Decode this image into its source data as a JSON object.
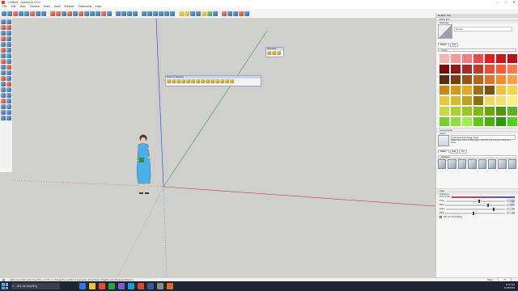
{
  "window": {
    "title": "Untitled - SketchUp 2019",
    "controls": [
      "–",
      "□",
      "✕"
    ]
  },
  "menu": [
    "File",
    "Edit",
    "View",
    "Camera",
    "Draw",
    "Tools",
    "Window",
    "Extensions",
    "Help"
  ],
  "floating": {
    "standard": {
      "title": "Standard"
    },
    "views": {
      "title": "Tools on Surface"
    }
  },
  "tray": {
    "title": "Default Tray",
    "entity_info": "Entity Info",
    "materials": {
      "header": "Materials",
      "name_placeholder": "Default",
      "tabs": [
        "Select",
        "Edit"
      ],
      "category": "Colors",
      "swatch_colors": [
        "#f7b6b6",
        "#f59a9a",
        "#f07f7f",
        "#e84d4d",
        "#e02020",
        "#c81818",
        "#b01414",
        "#7a0c0c",
        "#8b1a1a",
        "#a52a2a",
        "#c0392b",
        "#e74c3c",
        "#ff5a36",
        "#ff7a4f",
        "#5a2e0c",
        "#7a3f10",
        "#9a5216",
        "#b8641e",
        "#d8782a",
        "#f08c30",
        "#ffa040",
        "#c68a1a",
        "#d49a20",
        "#e0aa28",
        "#a07018",
        "#7a5410",
        "#f2c040",
        "#ffd24a",
        "#e6c840",
        "#d8b830",
        "#c4a020",
        "#8a7010",
        "#f0d860",
        "#f8e070",
        "#fff080",
        "#c8d840",
        "#b0d030",
        "#98c820",
        "#80b818",
        "#68a810",
        "#509808",
        "#60b020",
        "#7ad030",
        "#8ee040",
        "#a0f050",
        "#60c818",
        "#48b010",
        "#309808",
        "#50d020"
      ]
    },
    "components": "Components",
    "styles": {
      "header": "Styles",
      "style_name": "Architectural Design Style",
      "style_desc": "Default face colors. Profile edges. Light blue sky and gray background colors.",
      "tabs": [
        "Select",
        "Edit",
        "Mix"
      ],
      "category": "In Model",
      "thumbs": 8
    },
    "tags": "Tags",
    "shadows": {
      "header": "Shadows",
      "tz": "UTC-07:00",
      "time_label": "Time",
      "time_val": "01:30 PM",
      "date_label": "Date",
      "date_val": "11/08",
      "light_label": "Light",
      "light_val": "80",
      "dark_label": "Dark",
      "dark_val": "45",
      "sun_label": "Use sun for shading"
    }
  },
  "status": {
    "hint": "Click to set start point. Use Ctrl + or Ctrl - to change the number of segments. Arrow keys = Toggle Lock Inference Direction.",
    "measure_label": "Sides",
    "measure_value": "24"
  },
  "taskbar": {
    "search_placeholder": "Ask me anything",
    "app_colors": [
      "#2d7dd2",
      "#f4c23b",
      "#e24d3c",
      "#2f9e44",
      "#7b5cd6",
      "#1b9ad6",
      "#d64a2f",
      "#3c5a8f",
      "#8a8a8a",
      "#e06a2a"
    ],
    "time": "9:42 AM",
    "date": "11/8/2019"
  },
  "colors": {
    "axis_blue": "#3b5bd3",
    "axis_green": "#3aa13a",
    "axis_red": "#c94040",
    "figure_dress": "#4aaee8"
  }
}
